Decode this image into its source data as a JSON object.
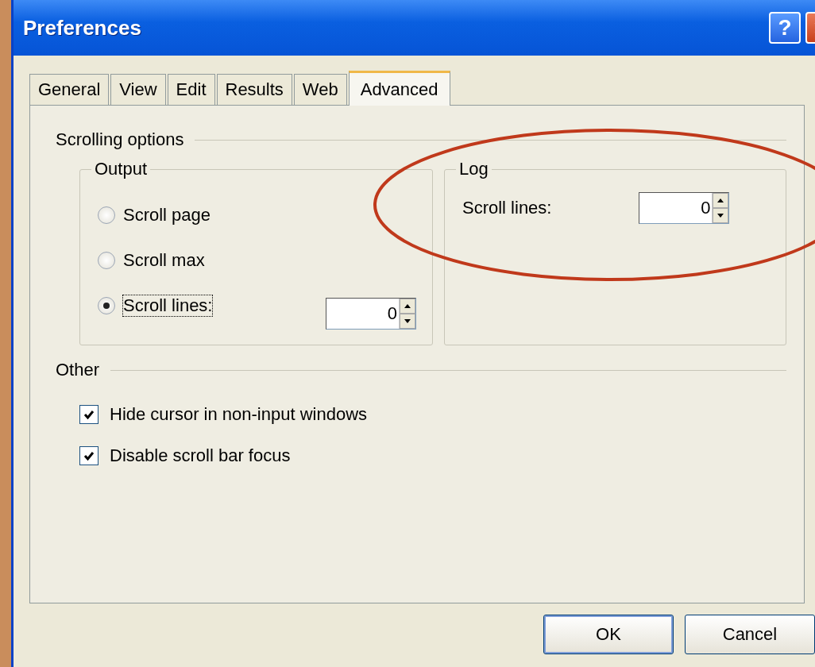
{
  "window": {
    "title": "Preferences"
  },
  "title_buttons": [
    {
      "kind": "help",
      "label": "?"
    },
    {
      "kind": "close"
    }
  ],
  "tabs": [
    {
      "label": "General",
      "selected": false
    },
    {
      "label": "View",
      "selected": false
    },
    {
      "label": "Edit",
      "selected": false
    },
    {
      "label": "Results",
      "selected": false
    },
    {
      "label": "Web",
      "selected": false
    },
    {
      "label": "Advanced",
      "selected": true
    }
  ],
  "scrolling_options": {
    "label": "Scrolling options",
    "output": {
      "label": "Output",
      "radios": [
        {
          "label": "Scroll page",
          "selected": false,
          "focused": false
        },
        {
          "label": "Scroll max",
          "selected": false,
          "focused": false
        },
        {
          "label": "Scroll lines:",
          "selected": true,
          "focused": true
        }
      ],
      "spinner": {
        "value": "0"
      }
    },
    "log": {
      "label": "Log",
      "field_label": "Scroll lines:",
      "spinner": {
        "value": "0"
      }
    }
  },
  "other": {
    "label": "Other",
    "checkboxes": [
      {
        "label": "Hide cursor in non-input windows",
        "checked": true
      },
      {
        "label": "Disable scroll bar focus",
        "checked": true
      }
    ]
  },
  "buttons": [
    "OK",
    "Cancel"
  ]
}
